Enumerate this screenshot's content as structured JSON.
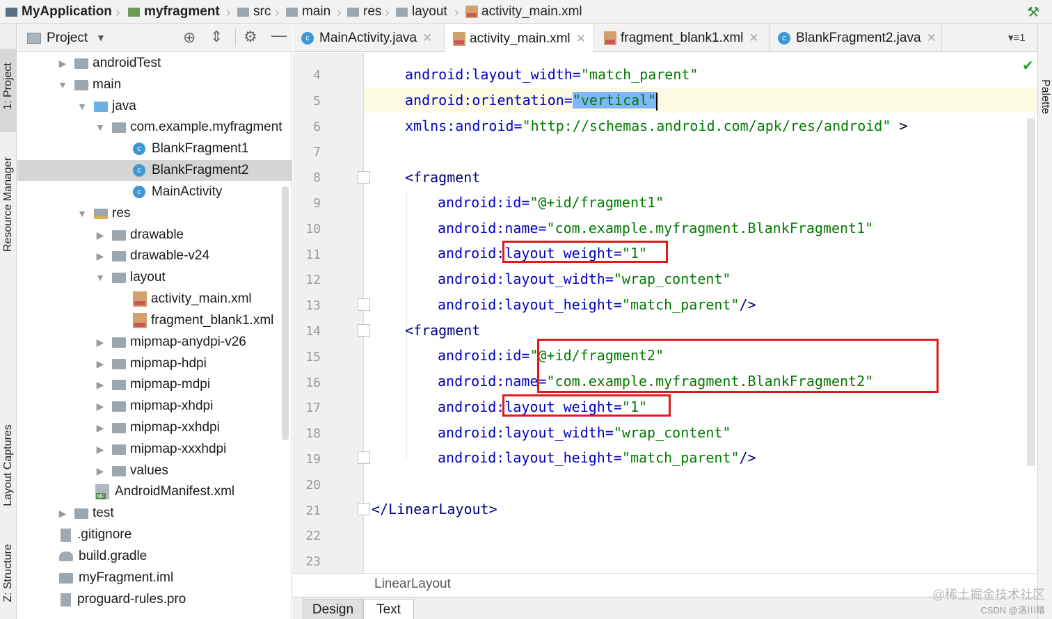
{
  "navbar": {
    "crumbs": [
      "MyApplication",
      "myfragment",
      "src",
      "main",
      "res",
      "layout",
      "activity_main.xml"
    ]
  },
  "left_strip": {
    "tabs": [
      "1: Project",
      "Resource Manager",
      "Layout Captures",
      "Z: Structure"
    ]
  },
  "right_strip": {
    "tabs": [
      "Palette"
    ]
  },
  "project_panel": {
    "title": "Project",
    "tree": [
      {
        "label": "androidTest",
        "icon": "folder-icon",
        "arrow": "right"
      },
      {
        "label": "main",
        "icon": "folder-icon",
        "arrow": "down"
      },
      {
        "label": "java",
        "icon": "folder-icon",
        "arrow": "down"
      },
      {
        "label": "com.example.myfragment",
        "icon": "package-icon",
        "arrow": "down"
      },
      {
        "label": "BlankFragment1",
        "icon": "class-icon"
      },
      {
        "label": "BlankFragment2",
        "icon": "class-icon",
        "selected": true
      },
      {
        "label": "MainActivity",
        "icon": "class-icon"
      },
      {
        "label": "res",
        "icon": "res-folder-icon",
        "arrow": "down"
      },
      {
        "label": "drawable",
        "icon": "folder-icon",
        "arrow": "right"
      },
      {
        "label": "drawable-v24",
        "icon": "folder-icon",
        "arrow": "right"
      },
      {
        "label": "layout",
        "icon": "folder-icon",
        "arrow": "down"
      },
      {
        "label": "activity_main.xml",
        "icon": "xml-file-icon"
      },
      {
        "label": "fragment_blank1.xml",
        "icon": "xml-file-icon"
      },
      {
        "label": "mipmap-anydpi-v26",
        "icon": "folder-icon",
        "arrow": "right"
      },
      {
        "label": "mipmap-hdpi",
        "icon": "folder-icon",
        "arrow": "right"
      },
      {
        "label": "mipmap-mdpi",
        "icon": "folder-icon",
        "arrow": "right"
      },
      {
        "label": "mipmap-xhdpi",
        "icon": "folder-icon",
        "arrow": "right"
      },
      {
        "label": "mipmap-xxhdpi",
        "icon": "folder-icon",
        "arrow": "right"
      },
      {
        "label": "mipmap-xxxhdpi",
        "icon": "folder-icon",
        "arrow": "right"
      },
      {
        "label": "values",
        "icon": "folder-icon",
        "arrow": "right"
      },
      {
        "label": "AndroidManifest.xml",
        "icon": "manifest-icon"
      },
      {
        "label": "test",
        "icon": "folder-icon",
        "arrow": "right"
      },
      {
        "label": ".gitignore",
        "icon": "file-icon"
      },
      {
        "label": "build.gradle",
        "icon": "gradle-icon"
      },
      {
        "label": "myFragment.iml",
        "icon": "iml-icon"
      },
      {
        "label": "proguard-rules.pro",
        "icon": "file-icon"
      }
    ]
  },
  "editor_tabs": [
    {
      "label": "MainActivity.java",
      "icon": "class-icon"
    },
    {
      "label": "activity_main.xml",
      "icon": "xml-file-icon",
      "active": true
    },
    {
      "label": "fragment_blank1.xml",
      "icon": "xml-file-icon"
    },
    {
      "label": "BlankFragment2.java",
      "icon": "class-icon"
    }
  ],
  "tab_overflow": "▾≡1",
  "editor": {
    "line_numbers": [
      "4",
      "5",
      "6",
      "7",
      "8",
      "9",
      "10",
      "11",
      "12",
      "13",
      "14",
      "15",
      "16",
      "17",
      "18",
      "19",
      "20",
      "21",
      "22",
      "23"
    ],
    "code": {
      "l4_name": "android:layout_width=",
      "l4_value": "\"match_parent\"",
      "l5_name": "android:orientation=",
      "l5_value": "\"vertical\"",
      "l6_name": "xmlns:android=",
      "l6_value": "\"http://schemas.android.com/apk/res/android\"",
      "l6_close": " >",
      "l8_tag": "<fragment",
      "l9_name": "android:id=",
      "l9_value": "\"@+id/fragment1\"",
      "l10_name": "android:name=",
      "l10_value": "\"com.example.myfragment.BlankFragment1\"",
      "l11_name": "android:layout_weight=",
      "l11_value": "\"1\"",
      "l12_name": "android:layout_width=",
      "l12_value": "\"wrap_content\"",
      "l13_name": "android:layout_height=",
      "l13_value": "\"match_parent\"",
      "l13_close": "/>",
      "l14_tag": "<fragment",
      "l15_name": "android:id=",
      "l15_value": "\"@+id/fragment2\"",
      "l16_name": "android:name=",
      "l16_value": "\"com.example.myfragment.BlankFragment2\"",
      "l17_name": "android:layout_weight=",
      "l17_value": "\"1\"",
      "l18_name": "android:layout_width=",
      "l18_value": "\"wrap_content\"",
      "l19_name": "android:layout_height=",
      "l19_value": "\"match_parent\"",
      "l19_close": "/>",
      "l21_tag": "</LinearLayout>"
    },
    "structure_breadcrumb": "LinearLayout"
  },
  "bottom_tabs": [
    "Design",
    "Text"
  ],
  "watermark": {
    "line1": "@稀土掘金技术社区",
    "line2": "CSDN @洛川晴"
  },
  "colors": {
    "attr_name": "#0000c0",
    "attr_value": "#007a00",
    "tag": "#000080",
    "annotation_box": "#e01a1a",
    "selection": "#7fb6ff"
  }
}
